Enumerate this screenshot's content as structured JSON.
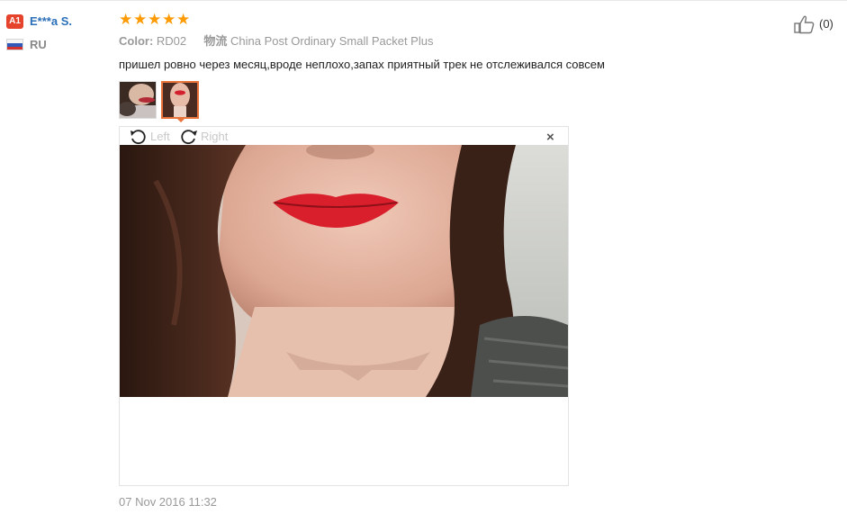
{
  "reviewer": {
    "level_badge": "A1",
    "name": "E***a S.",
    "country": "RU"
  },
  "rating": {
    "stars": 5,
    "max": 5,
    "color": "#ff9a00"
  },
  "meta": {
    "color_key": "Color:",
    "color_value": "RD02",
    "shipping_key": "物流",
    "shipping_value": "China Post Ordinary Small Packet Plus"
  },
  "review_text": "пришел ровно через месяц,вроде неплохо,запах приятный трек не отслеживался совсем",
  "photos": {
    "count": 2,
    "selected": 2
  },
  "viewer": {
    "rotate_left_label": "Left",
    "rotate_right_label": "Right",
    "close_label": "×"
  },
  "helpful": {
    "count_label": "(0)"
  },
  "date": "07 Nov 2016 11:32",
  "colors": {
    "accent": "#e8743b",
    "name_link": "#2a6fb8",
    "badge": "#e5432b"
  }
}
